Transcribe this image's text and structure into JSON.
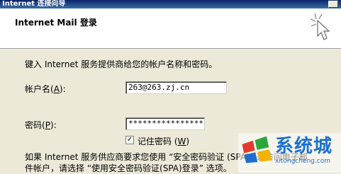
{
  "window": {
    "title": "Internet 连接向导"
  },
  "header": {
    "title": "Internet Mail 登录"
  },
  "body": {
    "intro": "键入 Internet 服务提供商给您的帐户名称和密码。",
    "account": {
      "label_prefix": "帐户名(",
      "accesskey": "A",
      "label_suffix": "):",
      "value": "263@263.zj.cn"
    },
    "password": {
      "label_prefix": "密码(",
      "accesskey": "P",
      "label_suffix": "):",
      "value": "******************"
    },
    "remember": {
      "label_prefix": "记住密码 (",
      "accesskey": "W",
      "label_suffix": ")",
      "checked": true
    },
    "note_line1": "如果 Internet 服务供应商要求您使用 “安全密码验证 (SPA)” 来访问电子邮",
    "note_line2": "件帐户，请选择 “使用安全密码验证(SPA)登录” 选项。"
  },
  "watermark": {
    "text": "系统城",
    "sub": "xitongcheng.com",
    "colors": [
      "#e23b2e",
      "#2aa63b",
      "#1a6fd1",
      "#f2b300"
    ]
  }
}
